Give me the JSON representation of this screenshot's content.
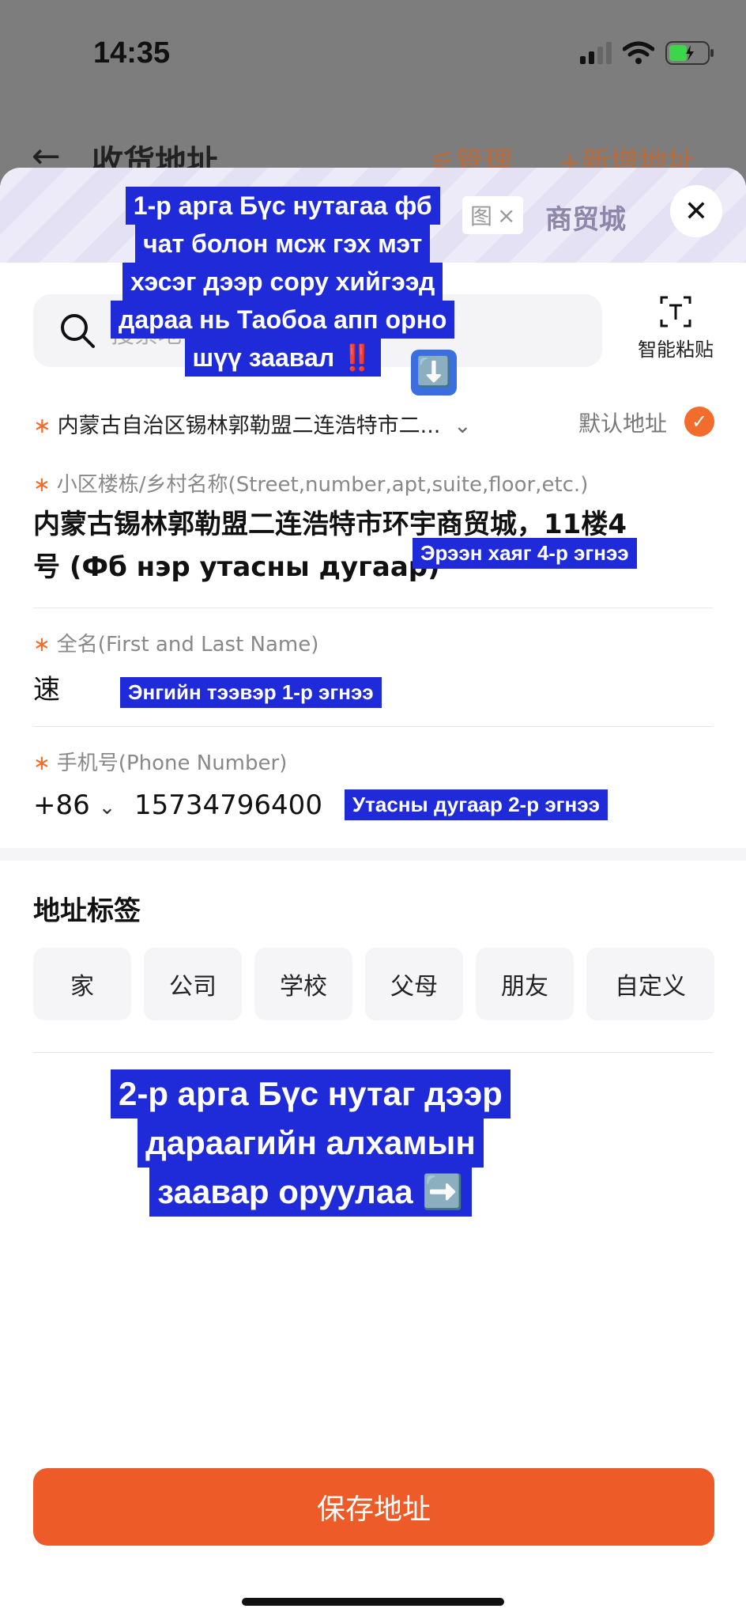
{
  "status": {
    "time": "14:35"
  },
  "background_header": {
    "back_icon": "arrow-left-icon",
    "title": "收货地址",
    "manage_label": "管理",
    "add_label": "新增地址"
  },
  "map": {
    "chip_text": "图",
    "chip_close": "×",
    "place_text": "商贸城"
  },
  "close_icon": "close-icon",
  "search": {
    "placeholder": "搜索地"
  },
  "smart_paste": {
    "label": "智能粘贴",
    "icon": "text-scan-icon"
  },
  "region": {
    "value": "内蒙古自治区锡林郭勒盟二连浩特市二...",
    "chevron": "⌄"
  },
  "default_address": {
    "label": "默认地址",
    "checked": true
  },
  "address_field": {
    "label": "小区楼栋/乡村名称(Street,number,apt,suite,floor,etc.)",
    "value_line1": "内蒙古锡林郭勒盟二连浩特市环宇商贸城，11楼4",
    "value_line2": "号 (Фб нэр утасны дугаар)"
  },
  "name_field": {
    "label": "全名(First and Last Name)",
    "value": "速"
  },
  "phone_field": {
    "label": "手机号(Phone Number)",
    "country_code": "+86",
    "value": "15734796400"
  },
  "tags": {
    "title": "地址标签",
    "items": [
      "家",
      "公司",
      "学校",
      "父母",
      "朋友",
      "自定义"
    ]
  },
  "save_button": "保存地址",
  "annotations": {
    "method1_lines": [
      "1-р арга Бүс нутагаа  фб",
      "чат болон мсж гэх мэт",
      "хэсэг дээр сору хийгээд",
      "дараа нь Таобоа апп орно",
      "шүү заавал"
    ],
    "method1_mark": "‼️",
    "arrow_down": "⬇️",
    "address_note": "Эрээн хаяг 4-р эгнээ",
    "name_note": "Энгийн тээвэр  1-р эгнээ",
    "phone_note": "Утасны дугаар 2-р эгнээ",
    "method2_lines": [
      "2-р арга Бүс нутаг дээр",
      "дараагийн алхамын",
      "заавар оруулаа"
    ],
    "method2_arrow": "➡️"
  },
  "colors": {
    "accent": "#f26d2b",
    "save_button": "#ec5b28",
    "annotation_blue": "#1f2ad8"
  }
}
